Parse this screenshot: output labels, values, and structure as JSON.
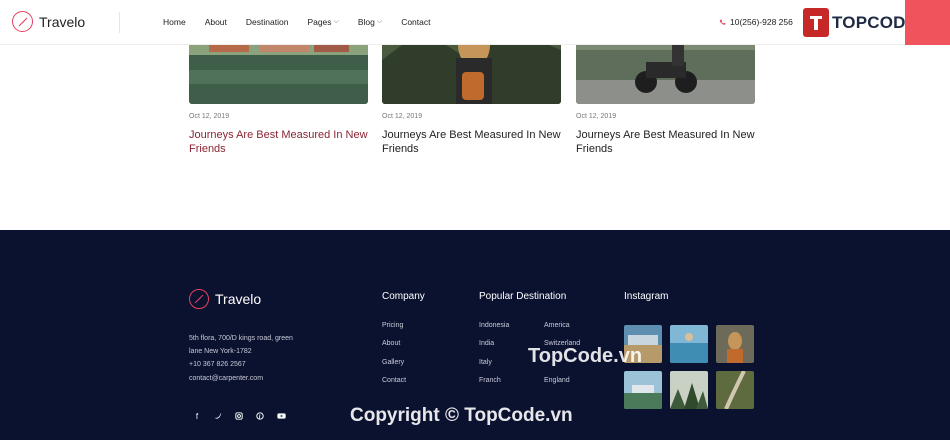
{
  "header": {
    "logo_text": "Travelo",
    "nav": [
      {
        "label": "Home"
      },
      {
        "label": "About"
      },
      {
        "label": "Destination"
      },
      {
        "label": "Pages"
      },
      {
        "label": "Blog"
      },
      {
        "label": "Contact"
      }
    ],
    "phone": "10(256)-928 256",
    "brand": "TOPCODE.VN"
  },
  "posts": [
    {
      "date": "Oct 12, 2019",
      "title": "Journeys Are Best Measured In New Friends",
      "image": "lake-village-photo"
    },
    {
      "date": "Oct 12, 2019",
      "title": "Journeys Are Best Measured In New Friends",
      "image": "hiker-backpack-photo"
    },
    {
      "date": "Oct 12, 2019",
      "title": "Journeys Are Best Measured In New Friends",
      "image": "motorbike-road-photo"
    }
  ],
  "footer": {
    "logo_text": "Travelo",
    "address": [
      "5th flora, 700/D kings road, green",
      "lane New York-1782",
      "+10 367 826 2567",
      "contact@carpenter.com"
    ],
    "company": {
      "title": "Company",
      "links": [
        "Pricing",
        "About",
        "Gallery",
        "Contact"
      ]
    },
    "popular": {
      "title": "Popular Destination",
      "col1": [
        "Indonesia",
        "India",
        "Italy",
        "Franch"
      ],
      "col2": [
        "America",
        "Switzerland",
        "",
        "England"
      ]
    },
    "instagram": {
      "title": "Instagram"
    },
    "social": [
      "f",
      "t",
      "ig",
      "p",
      "yt"
    ]
  },
  "watermarks": {
    "top": "TopCode.vn",
    "bottom": "Copyright © TopCode.vn"
  },
  "colors": {
    "accent": "#e4405f",
    "footer_bg": "#0b1230",
    "brand_red": "#c62828"
  }
}
